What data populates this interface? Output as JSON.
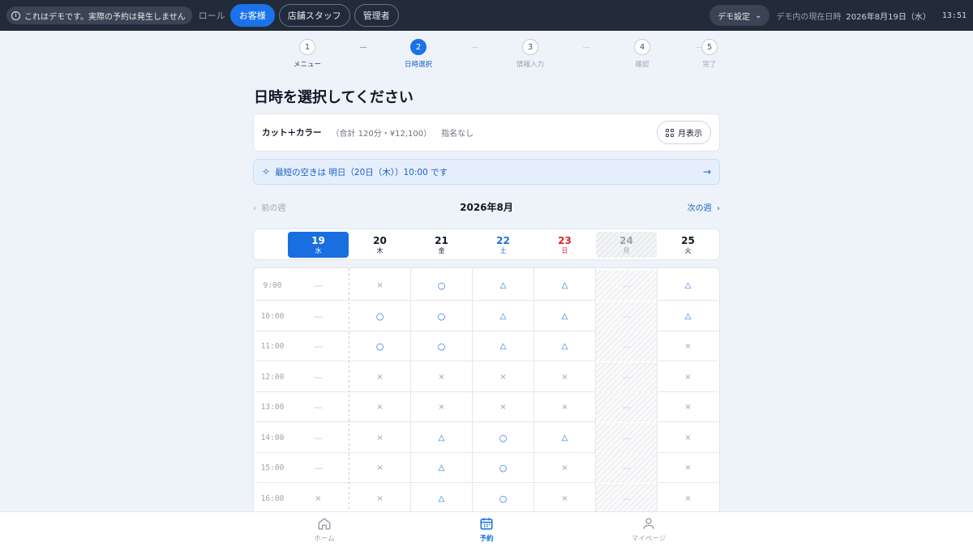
{
  "topbar": {
    "demo_notice": "これはデモです。実際の予約は発生しません",
    "role_label": "ロール",
    "roles": [
      {
        "label": "お客様",
        "active": true
      },
      {
        "label": "店舗スタッフ",
        "active": false
      },
      {
        "label": "管理者",
        "active": false
      }
    ],
    "demo_settings": "デモ設定",
    "now_label": "デモ内の現在日時",
    "now_date": "2026年8月19日（水）",
    "now_time": "13:51"
  },
  "stepper": {
    "steps": [
      {
        "num": "1",
        "label": "メニュー",
        "state": "done"
      },
      {
        "num": "2",
        "label": "日時選択",
        "state": "active"
      },
      {
        "num": "3",
        "label": "情報入力",
        "state": "todo"
      },
      {
        "num": "4",
        "label": "確認",
        "state": "todo"
      },
      {
        "num": "5",
        "label": "完了",
        "state": "todo"
      }
    ]
  },
  "page_title": "日時を選択してください",
  "summary": {
    "menu_name": "カット＋カラー",
    "menu_detail": "（合計 120分・¥12,100）",
    "nominee": "指名なし",
    "month_view_label": "月表示"
  },
  "earliest": {
    "text": "最短の空きは 明日（20日（木））10:00 です"
  },
  "week_nav": {
    "prev": "前の週",
    "month": "2026年8月",
    "next": "次の週"
  },
  "days": [
    {
      "num": "19",
      "wd": "水",
      "kind": "selected"
    },
    {
      "num": "20",
      "wd": "木",
      "kind": "normal"
    },
    {
      "num": "21",
      "wd": "金",
      "kind": "normal"
    },
    {
      "num": "22",
      "wd": "土",
      "kind": "sat"
    },
    {
      "num": "23",
      "wd": "日",
      "kind": "sun"
    },
    {
      "num": "24",
      "wd": "月",
      "kind": "closed"
    },
    {
      "num": "25",
      "wd": "火",
      "kind": "normal"
    }
  ],
  "slots": [
    {
      "time": "9:00",
      "cells": [
        "—",
        "×",
        "○",
        "△",
        "△",
        "—",
        "△"
      ]
    },
    {
      "time": "10:00",
      "cells": [
        "—",
        "○",
        "○",
        "△",
        "△",
        "—",
        "△"
      ]
    },
    {
      "time": "11:00",
      "cells": [
        "—",
        "○",
        "○",
        "△",
        "△",
        "—",
        "×"
      ]
    },
    {
      "time": "12:00",
      "cells": [
        "—",
        "×",
        "×",
        "×",
        "×",
        "—",
        "×"
      ]
    },
    {
      "time": "13:00",
      "cells": [
        "—",
        "×",
        "×",
        "×",
        "×",
        "—",
        "×"
      ]
    },
    {
      "time": "14:00",
      "cells": [
        "—",
        "×",
        "△",
        "○",
        "△",
        "—",
        "×"
      ]
    },
    {
      "time": "15:00",
      "cells": [
        "—",
        "×",
        "△",
        "○",
        "×",
        "—",
        "×"
      ]
    },
    {
      "time": "16:00",
      "cells": [
        "×",
        "×",
        "△",
        "○",
        "×",
        "—",
        "×"
      ]
    }
  ],
  "bottom_nav": [
    {
      "label": "ホーム",
      "icon": "home-icon",
      "active": false
    },
    {
      "label": "予約",
      "icon": "calendar-icon",
      "active": true
    },
    {
      "label": "マイページ",
      "icon": "user-icon",
      "active": false
    }
  ],
  "colors": {
    "accent": "#1a73e8",
    "topbar": "#222b3a",
    "saturday": "#1a6fe0",
    "sunday": "#dc2626"
  }
}
